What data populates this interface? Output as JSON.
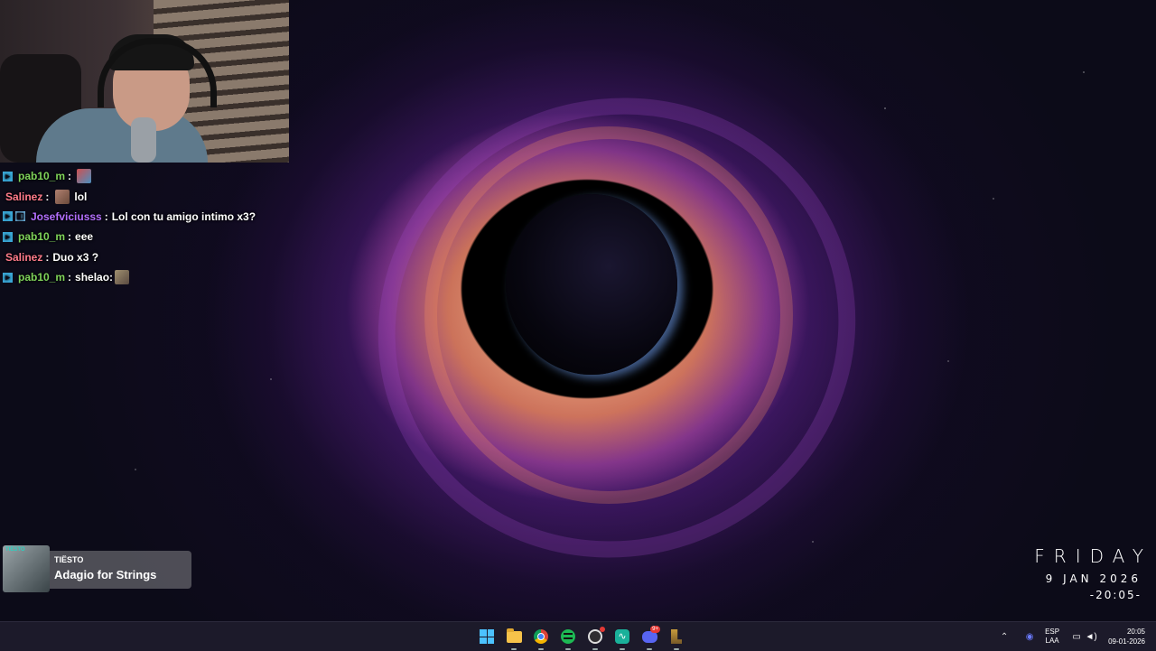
{
  "chat": {
    "messages": [
      {
        "user": "pab10_m",
        "text": "",
        "emote": "pixel-emote"
      },
      {
        "user": "Salinez",
        "text": "lol",
        "emote": "face-emote"
      },
      {
        "user": "Josefviciusss",
        "text": "Lol con tu amigo intimo x3?"
      },
      {
        "user": "pab10_m",
        "text": "eee"
      },
      {
        "user": "Salinez",
        "text": "Duo x3 ?"
      },
      {
        "user": "pab10_m",
        "text": "shelao:",
        "emote": "face-emote"
      }
    ],
    "separator": ":"
  },
  "now_playing": {
    "cover_text": "TIËSTO",
    "artist": "TIËSTO",
    "title": "Adagio for Strings"
  },
  "desktop_clock": {
    "day": "FRIDAY",
    "date": "9 JAN 2026",
    "time": "-20:05-"
  },
  "taskbar": {
    "apps": [
      "windows-start",
      "file-explorer",
      "chrome",
      "spotify",
      "obs",
      "pulse-app",
      "discord",
      "league-of-legends"
    ],
    "discord_badge": "9+",
    "tray": {
      "lang_1": "ESP",
      "lang_2": "LAA",
      "time": "20:05",
      "date": "09-01-2026"
    }
  },
  "colors": {
    "username_green": "#7fd35a",
    "username_pink": "#ff7b8a",
    "username_purple": "#b470ff",
    "taskbar_bg": "#1c1a2a"
  }
}
